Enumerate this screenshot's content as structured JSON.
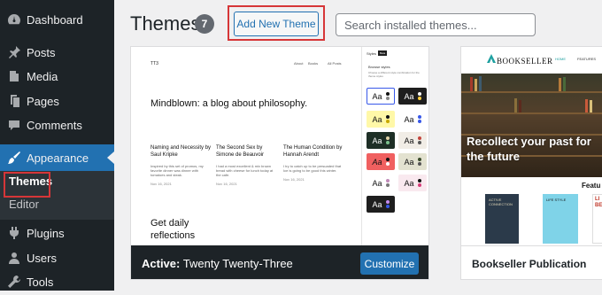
{
  "sidebar": {
    "items": [
      {
        "label": "Dashboard",
        "icon": "dashboard-icon"
      },
      {
        "label": "Posts",
        "icon": "pin-icon"
      },
      {
        "label": "Media",
        "icon": "media-icon"
      },
      {
        "label": "Pages",
        "icon": "pages-icon"
      },
      {
        "label": "Comments",
        "icon": "comment-icon"
      },
      {
        "label": "Appearance",
        "icon": "paintbrush-icon",
        "active": true
      },
      {
        "label": "Plugins",
        "icon": "plugin-icon"
      },
      {
        "label": "Users",
        "icon": "users-icon"
      },
      {
        "label": "Tools",
        "icon": "wrench-icon"
      }
    ],
    "submenu": {
      "themes": "Themes",
      "editor": "Editor"
    }
  },
  "header": {
    "title": "Themes",
    "count": "7",
    "add_new_label": "Add New Theme",
    "search_placeholder": "Search installed themes..."
  },
  "active_theme": {
    "active_prefix": "Active:",
    "name": "Twenty Twenty-Three",
    "customize_label": "Customize",
    "preview": {
      "logo": "TT3",
      "nav": [
        "About",
        "Books",
        "All Posts"
      ],
      "headline": "Mindblown: a blog about philosophy.",
      "posts": [
        {
          "title": "Naming and Necessity by Saul Kripke",
          "excerpt": "Inspired by this set of promos, my favorite dinner was dinner with tomatoes and steak.",
          "date": "Nov 16, 2021"
        },
        {
          "title": "The Second Sex by Simone de Beauvoir",
          "excerpt": "I had a most excellent & mix brown bread with cheese for lunch today at the cafe.",
          "date": "Nov 16, 2021"
        },
        {
          "title": "The Human Condition by Hannah Arendt",
          "excerpt": "I try to catch up to be persuaded that Ice is going to be good this winter.",
          "date": "Nov 16, 2021"
        }
      ],
      "footer_headline": "Get daily reflections",
      "styles_panel": {
        "top": "Styles",
        "beta": "Beta",
        "title": "Browse styles",
        "subtitle": "Choose a different style combination for the theme styles",
        "swatch_text": "Aa"
      }
    }
  },
  "second_theme": {
    "name": "Bookseller Publication",
    "preview": {
      "logo": "BOOKSELLER",
      "nav": [
        "HOME",
        "FEATURES"
      ],
      "hero_text": "Recollect your past for the future",
      "featured_label": "Featu",
      "book_cover_text": [
        "ACTIVE CONNECTION",
        "LIFE STYLE",
        "LI BE"
      ]
    }
  },
  "colors": {
    "sidebar_bg": "#1d2327",
    "accent": "#2271b1",
    "highlight_box": "#d63638"
  }
}
